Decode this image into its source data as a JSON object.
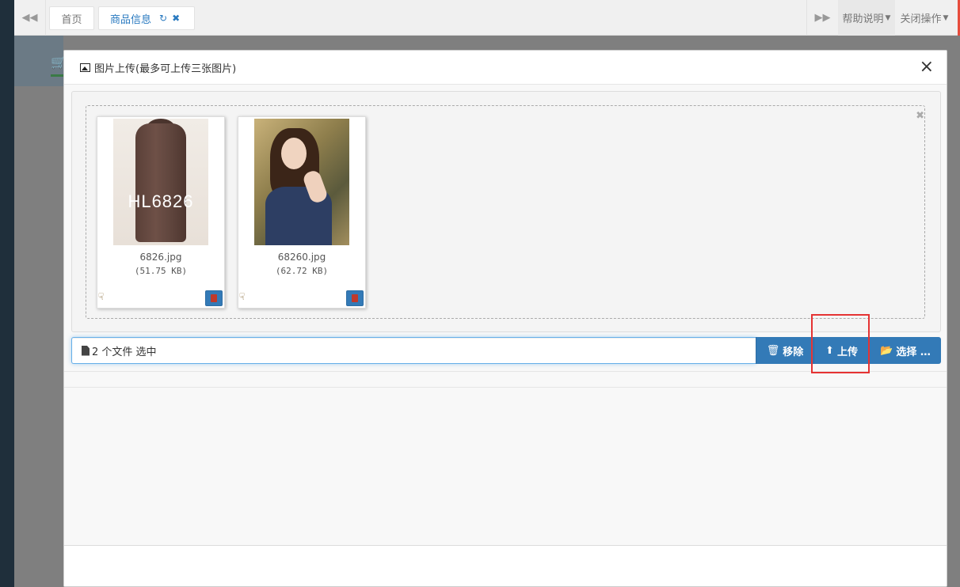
{
  "tabs": {
    "home_label": "首页",
    "active_label": "商品信息"
  },
  "header_menus": {
    "help_label": "帮助说明",
    "close_ops_label": "关闭操作"
  },
  "modal": {
    "title": "图片上传(最多可上传三张图片)",
    "close_glyph": "×"
  },
  "files": [
    {
      "name": "6826.jpg",
      "size": "(51.75 KB)",
      "watermark": "HL6826"
    },
    {
      "name": "68260.jpg",
      "size": "(62.72 KB)"
    }
  ],
  "file_input": {
    "caption": "2 个文件 选中",
    "remove_label": "移除",
    "upload_label": "上传",
    "select_label": "选择 …"
  },
  "colors": {
    "primary": "#337ab7",
    "highlight": "#e53333",
    "active_tab": "#2a7ac0"
  }
}
